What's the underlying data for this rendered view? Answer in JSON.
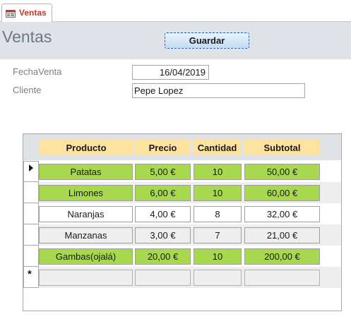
{
  "tab": {
    "label": "Ventas",
    "icon": "form-icon"
  },
  "form": {
    "title": "Ventas",
    "save_label": "Guardar"
  },
  "fields": {
    "fecha_label": "FechaVenta",
    "fecha_value": "16/04/2019",
    "cliente_label": "Cliente",
    "cliente_value": "Pepe Lopez"
  },
  "grid": {
    "columns": [
      "Producto",
      "Precio",
      "Cantidad",
      "Subtotal"
    ],
    "rows": [
      {
        "producto": "Patatas",
        "precio": "5,00 €",
        "cantidad": "10",
        "subtotal": "50,00 €",
        "highlight": true,
        "current": true
      },
      {
        "producto": "Limones",
        "precio": "6,00 €",
        "cantidad": "10",
        "subtotal": "60,00 €",
        "highlight": true,
        "current": false
      },
      {
        "producto": "Naranjas",
        "precio": "4,00 €",
        "cantidad": "8",
        "subtotal": "32,00 €",
        "highlight": false,
        "current": false
      },
      {
        "producto": "Manzanas",
        "precio": "3,00 €",
        "cantidad": "7",
        "subtotal": "21,00 €",
        "highlight": false,
        "current": false
      },
      {
        "producto": "Gambas(ojalá)",
        "precio": "20,00 €",
        "cantidad": "10",
        "subtotal": "200,00 €",
        "highlight": true,
        "current": false
      }
    ],
    "new_row_marker": "*"
  },
  "colors": {
    "highlight": "#a8d84e",
    "header_cell": "#fde39f",
    "band": "#dfe3e8",
    "tab_text": "#c0392b"
  }
}
